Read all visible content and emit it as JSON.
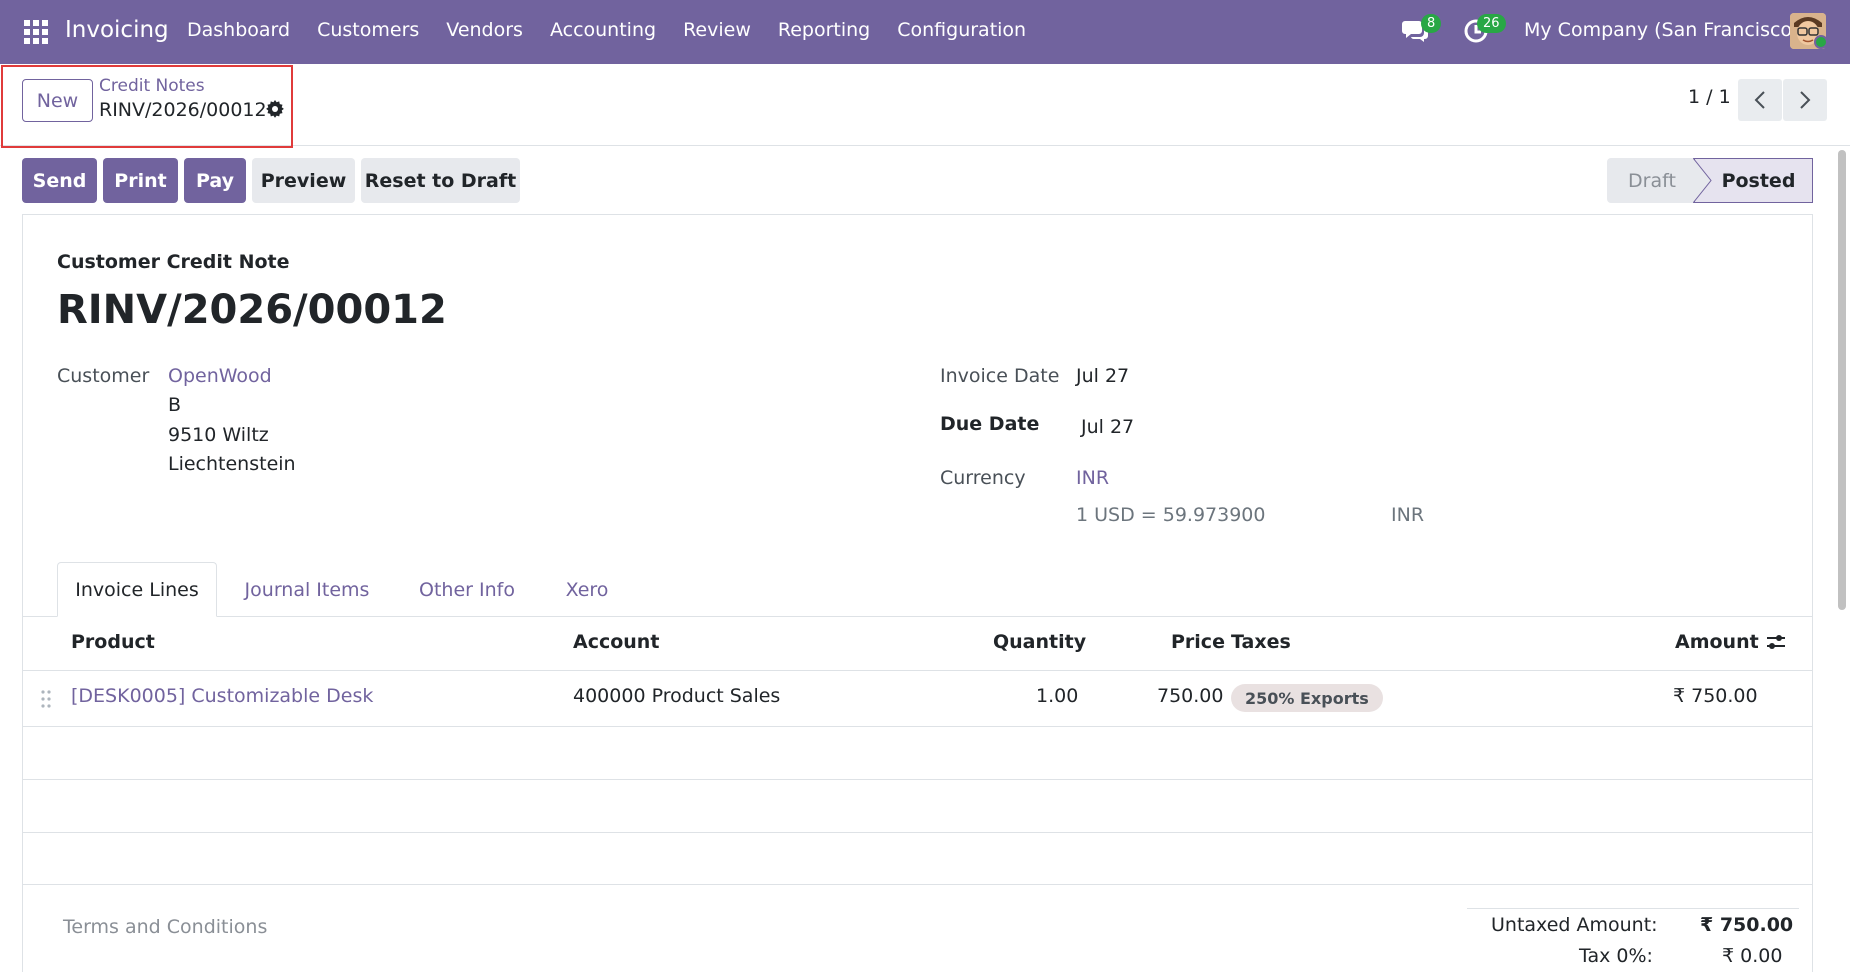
{
  "navbar": {
    "app_name": "Invoicing",
    "menu": [
      "Dashboard",
      "Customers",
      "Vendors",
      "Accounting",
      "Review",
      "Reporting",
      "Configuration"
    ],
    "messages_count": "8",
    "activities_count": "26",
    "company": "My Company (San Francisco)"
  },
  "control_panel": {
    "new_label": "New",
    "breadcrumb_parent": "Credit Notes",
    "breadcrumb_current": "RINV/2026/00012",
    "pager": "1 / 1"
  },
  "actions": {
    "send": "Send",
    "print": "Print",
    "pay": "Pay",
    "preview": "Preview",
    "reset": "Reset to Draft"
  },
  "status": {
    "draft": "Draft",
    "posted": "Posted",
    "current": "Posted"
  },
  "form": {
    "doc_type": "Customer Credit Note",
    "doc_name": "RINV/2026/00012",
    "customer_label": "Customer",
    "customer_name": "OpenWood",
    "customer_address": [
      "B",
      "9510 Wiltz",
      "Liechtenstein"
    ],
    "invoice_date_label": "Invoice Date",
    "invoice_date": "Jul 27",
    "due_date_label": "Due Date",
    "due_date": "Jul 27",
    "currency_label": "Currency",
    "currency": "INR",
    "rate_text": "1 USD = 59.973900",
    "rate_currency": "INR"
  },
  "tabs": [
    "Invoice Lines",
    "Journal Items",
    "Other Info",
    "Xero"
  ],
  "table": {
    "headers": {
      "product": "Product",
      "account": "Account",
      "quantity": "Quantity",
      "price": "Price",
      "taxes": "Taxes",
      "amount": "Amount"
    },
    "rows": [
      {
        "product": "[DESK0005] Customizable Desk",
        "account": "400000 Product Sales",
        "quantity": "1.00",
        "price": "750.00",
        "tax": "250% Exports",
        "amount": "₹ 750.00"
      }
    ]
  },
  "footer": {
    "terms_placeholder": "Terms and Conditions",
    "untaxed_label": "Untaxed Amount:",
    "untaxed_value": "₹ 750.00",
    "tax_label": "Tax 0%:",
    "tax_value": "₹ 0.00"
  },
  "colors": {
    "brand": "#71639e",
    "badge": "#28a745",
    "highlight": "#e03b3b"
  }
}
